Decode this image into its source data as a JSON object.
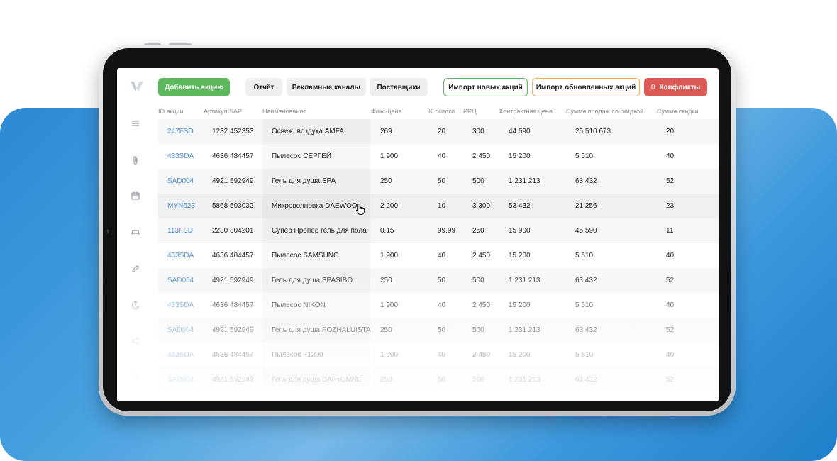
{
  "toolbar": {
    "add_label": "Добавить акцию",
    "report_label": "Отчёт",
    "channels_label": "Рекламные каналы",
    "suppliers_label": "Поставщики",
    "import_new_label": "Импорт новых акций",
    "import_updated_label": "Импорт обновленных акций",
    "conflicts_count": "0",
    "conflicts_label": "Конфликты"
  },
  "colors": {
    "accent_green": "#5cb85c",
    "accent_orange": "#f0ad4e",
    "danger_red": "#dc5a55",
    "link_blue": "#4a8fd4",
    "background_blue": "#2c8ad3"
  },
  "sidebar": {
    "logo_icon": "brand-logo-icon",
    "icons": [
      "menu-icon",
      "paperclip-icon",
      "calendar-icon",
      "car-icon",
      "pencil-icon",
      "moon-icon",
      "share-icon",
      "settings-icon"
    ]
  },
  "table": {
    "columns": [
      "ID акции",
      "Артикул SAP",
      "Наименование",
      "Фикс-цена",
      "% скидки",
      "РРЦ",
      "Контрактная цена",
      "Сумма продаж со скидкой",
      "Сумма скидки"
    ],
    "rows": [
      [
        "247FSD",
        "1232 452353",
        "Освеж. воздуха AMFA",
        "269",
        "20",
        "300",
        "44 590",
        "25 510 673",
        "20"
      ],
      [
        "433SDA",
        "4636 484457",
        "Пылесос СЕРГЕЙ",
        "1 900",
        "40",
        "2 450",
        "15 200",
        "5 510",
        "40"
      ],
      [
        "SAD004",
        "4921 592949",
        "Гель для душа SPA",
        "250",
        "50",
        "500",
        "1 231 213",
        "63 432",
        "52"
      ],
      [
        "MYN623",
        "5868 503032",
        "Микроволновка DAEWOO",
        "2 200",
        "10",
        "3 300",
        "53 432",
        "21 256",
        "23"
      ],
      [
        "113FSD",
        "2230 304201",
        "Супер Пропер гель для пола",
        "0.15",
        "99.99",
        "250",
        "15 900",
        "45 590",
        "11"
      ],
      [
        "433SDA",
        "4636 484457",
        "Пылесос SAMSUNG",
        "1 900",
        "40",
        "2 450",
        "15 200",
        "5 510",
        "40"
      ],
      [
        "SAD004",
        "4921 592949",
        "Гель для душа SPASIBO",
        "250",
        "50",
        "500",
        "1 231 213",
        "63 432",
        "52"
      ],
      [
        "433SDA",
        "4636 484457",
        "Пылесос NIKON",
        "1 900",
        "40",
        "2 450",
        "15 200",
        "5 510",
        "40"
      ],
      [
        "SAD004",
        "4921 592949",
        "Гель для душа POZHALUISTA",
        "250",
        "50",
        "500",
        "1 231 213",
        "63 432",
        "52"
      ],
      [
        "433SDA",
        "4636 484457",
        "Пылесос F1200",
        "1 900",
        "40",
        "2 450",
        "15 200",
        "5 510",
        "40"
      ],
      [
        "SAD004",
        "4921 592949",
        "Гель для душа DAFTOMNE",
        "250",
        "50",
        "500",
        "1 231 213",
        "63 432",
        "52"
      ]
    ]
  }
}
